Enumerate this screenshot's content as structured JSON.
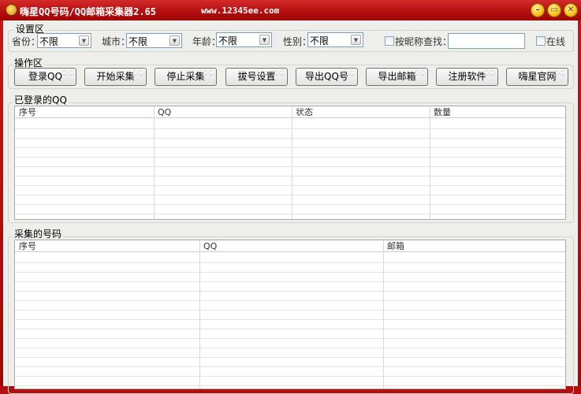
{
  "window": {
    "title": "嗨星QQ号码/QQ邮箱采集器2.65",
    "url": "www.12345ee.com",
    "minimize": "–",
    "maximize": "▭",
    "close": "✕"
  },
  "settings": {
    "group_label": "设置区",
    "province_label": "省份：",
    "province_value": "不限",
    "city_label": "城市：",
    "city_value": "不限",
    "age_label": "年龄：",
    "age_value": "不限",
    "gender_label": "性别：",
    "gender_value": "不限",
    "nickname_search_label": "按昵称查找：",
    "nickname_value": "",
    "online_label": "在线"
  },
  "operations": {
    "group_label": "操作区",
    "buttons": [
      "登录QQ",
      "开始采集",
      "停止采集",
      "拔号设置",
      "导出QQ号",
      "导出邮箱",
      "注册软件",
      "嗨星官网"
    ]
  },
  "logged_qq": {
    "group_label": "已登录的QQ",
    "columns": [
      "序号",
      "QQ",
      "状态",
      "数量"
    ],
    "rows": []
  },
  "collected": {
    "group_label": "采集的号码",
    "columns": [
      "序号",
      "QQ",
      "邮箱"
    ],
    "rows": []
  }
}
